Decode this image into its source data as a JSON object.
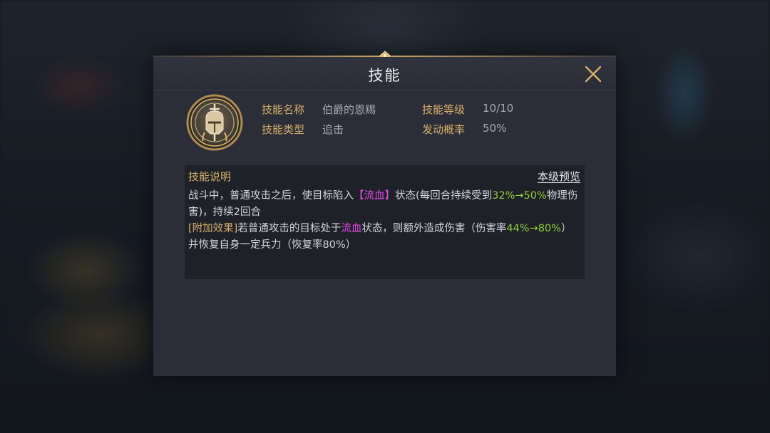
{
  "dialog": {
    "title": "技能",
    "close_icon": "close-x-icon"
  },
  "skill": {
    "icon": "knight-helmet-sword-icon",
    "name_label": "技能名称",
    "name_value": "伯爵的恩赐",
    "type_label": "技能类型",
    "type_value": "追击",
    "level_label": "技能等级",
    "level_value": "10/10",
    "chance_label": "发动概率",
    "chance_value": "50%"
  },
  "description": {
    "title": "技能说明",
    "preview_link": "本级预览",
    "line1_a": "战斗中，普通攻击之后，使目标陷入",
    "line1_tag": "【流血】",
    "line1_b": "状态(每回合持续受到",
    "line1_range": "32%→50%",
    "line1_c": "物理伤害)，持续2回合",
    "line2_tag": "[附加效果]",
    "line2_a": "若普通攻击的目标处于",
    "line2_status": "流血",
    "line2_b": "状态，则额外造成伤害（伤害率",
    "line2_range": "44%→80%",
    "line2_c": "）并恢复自身一定兵力（恢复率80%）"
  },
  "colors": {
    "accent_gold": "#d7b06a",
    "status_magenta": "#e14be8",
    "range_green": "#8fd13a",
    "panel": "#2b2d38"
  }
}
